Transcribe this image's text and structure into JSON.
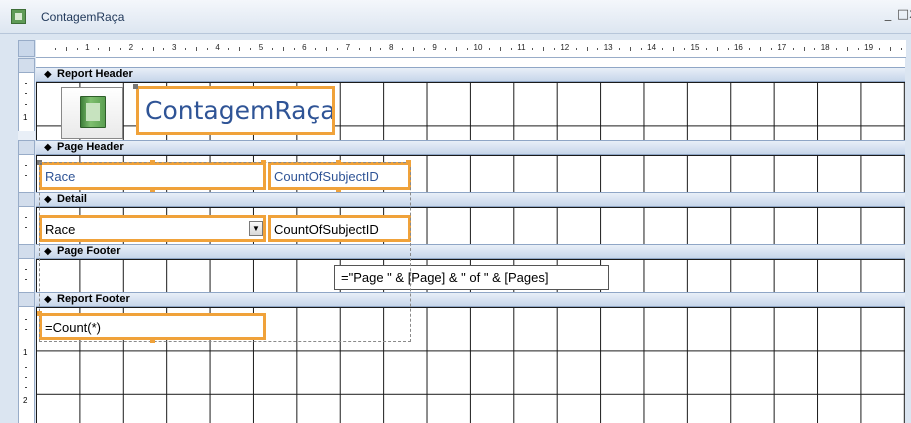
{
  "window": {
    "title": "ContagemRaça",
    "controls": {
      "minimize": "_",
      "maximize": "□",
      "close": "x"
    }
  },
  "ruler": {
    "numbers": [
      "1",
      "2",
      "3",
      "4",
      "5",
      "6",
      "7",
      "8",
      "9",
      "10",
      "11",
      "12",
      "13",
      "14",
      "15",
      "16",
      "17",
      "18",
      "19"
    ],
    "vertical_labels": [
      "1",
      "1",
      "2"
    ]
  },
  "sections": {
    "report_header": "Report Header",
    "page_header": "Page Header",
    "detail": "Detail",
    "page_footer": "Page Footer",
    "report_footer": "Report Footer"
  },
  "controls": {
    "report_title": "ContagemRaça",
    "page_header_race": "Race",
    "page_header_count": "CountOfSubjectID",
    "detail_race": "Race",
    "detail_count": "CountOfSubjectID",
    "page_footer_expr": "=\"Page \" & [Page] & \" of \" & [Pages]",
    "report_footer_expr": "=Count(*)"
  },
  "icons": {
    "section_arrow": "section-collapse-icon",
    "combo_arrow": "combo-dropdown-icon",
    "logo": "report-logo-icon",
    "window_icon": "report-window-icon"
  },
  "colors": {
    "selection": "#f0a23a",
    "label_text": "#2f5496",
    "section_bar": "#c7d6ea"
  }
}
